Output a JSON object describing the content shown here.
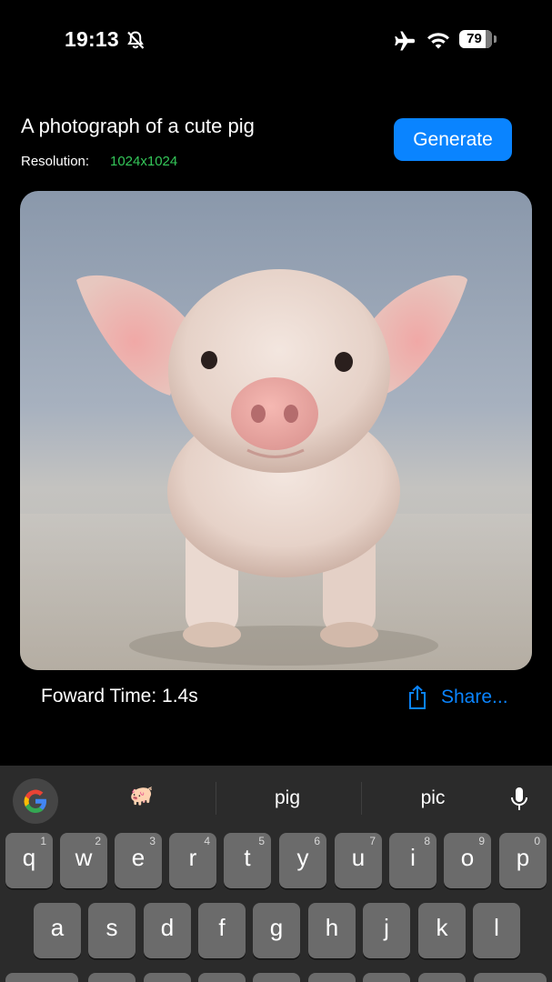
{
  "status_bar": {
    "time": "19:13",
    "silent_icon": "bell-slash-icon",
    "airplane_icon": "airplane-icon",
    "wifi_icon": "wifi-icon",
    "battery_level": "79"
  },
  "prompt": {
    "text": "A photograph of a cute pig",
    "resolution_label": "Resolution:",
    "resolution_value": "1024x1024",
    "resolution_color": "#34c759"
  },
  "generate_button": {
    "label": "Generate",
    "color": "#0a84ff"
  },
  "result": {
    "image_subject": "piglet-photo",
    "forward_time": "Foward Time: 1.4s",
    "share_label": "Share...",
    "share_icon": "share-icon"
  },
  "keyboard": {
    "suggestions": [
      "🐖",
      "pig",
      "pic"
    ],
    "google_icon": "google-g-icon",
    "mic_icon": "microphone-icon",
    "row1": [
      {
        "letter": "q",
        "num": "1"
      },
      {
        "letter": "w",
        "num": "2"
      },
      {
        "letter": "e",
        "num": "3"
      },
      {
        "letter": "r",
        "num": "4"
      },
      {
        "letter": "t",
        "num": "5"
      },
      {
        "letter": "y",
        "num": "6"
      },
      {
        "letter": "u",
        "num": "7"
      },
      {
        "letter": "i",
        "num": "8"
      },
      {
        "letter": "o",
        "num": "9"
      },
      {
        "letter": "p",
        "num": "0"
      }
    ],
    "row2": [
      "a",
      "s",
      "d",
      "f",
      "g",
      "h",
      "j",
      "k",
      "l"
    ]
  }
}
